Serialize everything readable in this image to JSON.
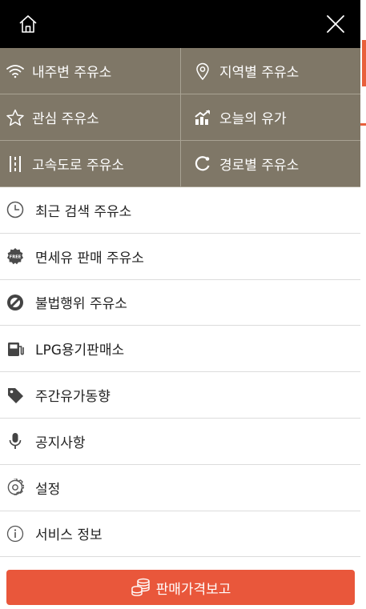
{
  "colors": {
    "topbar": "#000000",
    "grid_bg": "#7f7767",
    "accent": "#e9573b"
  },
  "topbar": {
    "home_icon": "home-icon",
    "close_icon": "close-icon"
  },
  "grid": [
    {
      "label": "내주변 주유소",
      "icon": "wifi-icon"
    },
    {
      "label": "지역별 주유소",
      "icon": "location-pin-icon"
    },
    {
      "label": "관심 주유소",
      "icon": "star-icon"
    },
    {
      "label": "오늘의 유가",
      "icon": "chart-trend-icon"
    },
    {
      "label": "고속도로 주유소",
      "icon": "highway-icon"
    },
    {
      "label": "경로별 주유소",
      "icon": "route-icon"
    }
  ],
  "menu": [
    {
      "label": "최근 검색 주유소",
      "icon": "clock-icon"
    },
    {
      "label": "면세유 판매 주유소",
      "icon": "free-badge-icon"
    },
    {
      "label": "불법행위 주유소",
      "icon": "prohibited-icon"
    },
    {
      "label": "LPG용기판매소",
      "icon": "gas-pump-icon"
    },
    {
      "label": "주간유가동향",
      "icon": "price-tag-icon"
    },
    {
      "label": "공지사항",
      "icon": "microphone-icon"
    },
    {
      "label": "설정",
      "icon": "gear-icon"
    },
    {
      "label": "서비스 정보",
      "icon": "info-icon"
    }
  ],
  "report_button": {
    "label": "판매가격보고",
    "icon": "coins-icon"
  }
}
